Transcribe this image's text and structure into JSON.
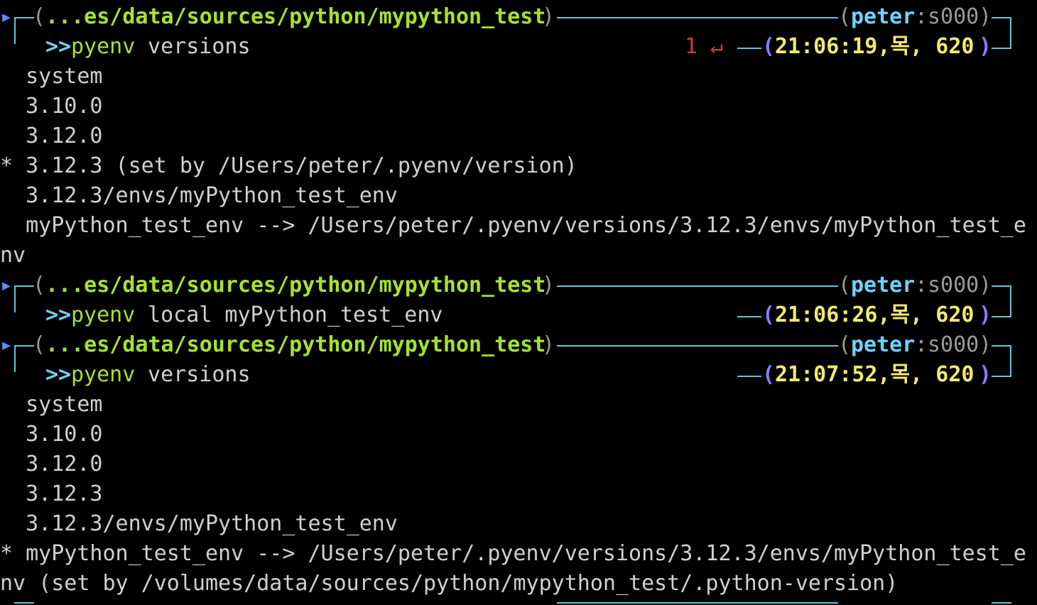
{
  "prompts": [
    {
      "path": "...es/data/sources/python/mypython_test",
      "user": "peter",
      "tty": "s000",
      "chevron": ">>",
      "command": "pyenv",
      "args": " versions",
      "exit_code": "1 ↵",
      "time": "21:06:19,목, 620"
    },
    {
      "path": "...es/data/sources/python/mypython_test",
      "user": "peter",
      "tty": "s000",
      "chevron": ">>",
      "command": "pyenv",
      "args": " local myPython_test_env",
      "exit_code": "",
      "time": "21:06:26,목, 620"
    },
    {
      "path": "...es/data/sources/python/mypython_test",
      "user": "peter",
      "tty": "s000",
      "chevron": ">>",
      "command": "pyenv",
      "args": " versions",
      "exit_code": "",
      "time": "21:07:52,목, 620"
    }
  ],
  "output1": [
    "  system",
    "  3.10.0",
    "  3.12.0",
    "* 3.12.3 (set by /Users/peter/.pyenv/version)",
    "  3.12.3/envs/myPython_test_env",
    "  myPython_test_env --> /Users/peter/.pyenv/versions/3.12.3/envs/myPython_test_e",
    "nv"
  ],
  "output2": [
    "  system",
    "  3.10.0",
    "  3.12.0",
    "  3.12.3",
    "  3.12.3/envs/myPython_test_env",
    "* myPython_test_env --> /Users/peter/.pyenv/versions/3.12.3/envs/myPython_test_e",
    "nv (set by /volumes/data/sources/python/mypython_test/.python-version)"
  ],
  "colors": {
    "background": "#000000",
    "path": "#a6e22e",
    "user": "#6fd3ff",
    "time": "#f1ea6b",
    "frame": "#5ec8d8",
    "error": "#d43a2c"
  }
}
